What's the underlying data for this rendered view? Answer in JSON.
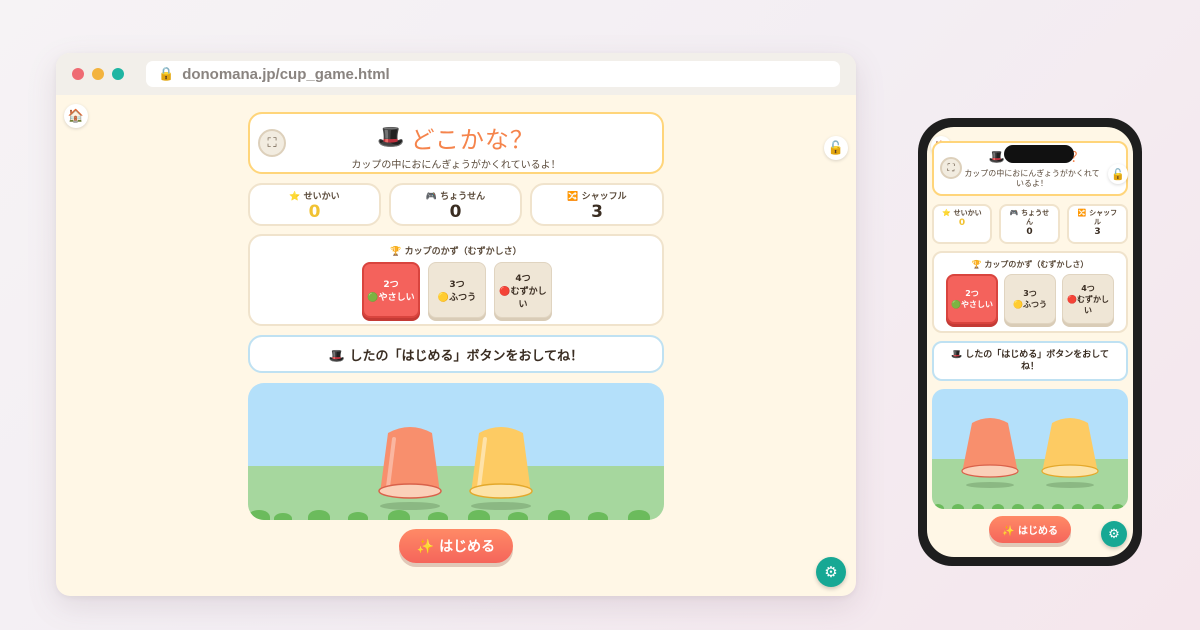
{
  "browser": {
    "url": "donomana.jp/cup_game.html"
  },
  "app": {
    "home_icon": "🏠",
    "lock_icon": "🔓",
    "gear_icon": "⚙",
    "expand_icon": "⛶",
    "title_icon": "🎩",
    "title": "どこかな？",
    "subtitle": "カップの中におにんぎょうがかくれているよ！",
    "stats": {
      "correct_label": "⭐ せいかい",
      "correct_value": "0",
      "challenges_label": "🎮 ちょうせん",
      "challenges_value": "0",
      "shuffles_label": "🔀 シャッフル",
      "shuffles_value": "3"
    },
    "difficulty": {
      "heading": "🏆 カップのかず（むずかしさ）",
      "options": [
        {
          "count": "2つ",
          "level": "🟢やさしい",
          "active": true
        },
        {
          "count": "3つ",
          "level": "🟡ふつう",
          "active": false
        },
        {
          "count": "4つ",
          "level": "🔴むずかしい",
          "active": false
        }
      ]
    },
    "message": "🎩 したの「はじめる」ボタンをおしてね！",
    "start_button": "✨ はじめる",
    "cups": [
      {
        "name": "cup-1",
        "color": "#f88f6d"
      },
      {
        "name": "cup-2",
        "color": "#fdcb63"
      }
    ]
  },
  "phone": {
    "stats": {
      "correct_label": "⭐ せいかい",
      "challenges_label": "🎮 ちょうせん",
      "shuffles_label": "🔀 シャッフル"
    },
    "difficulty_level_hard": "🔴むずかしい"
  }
}
